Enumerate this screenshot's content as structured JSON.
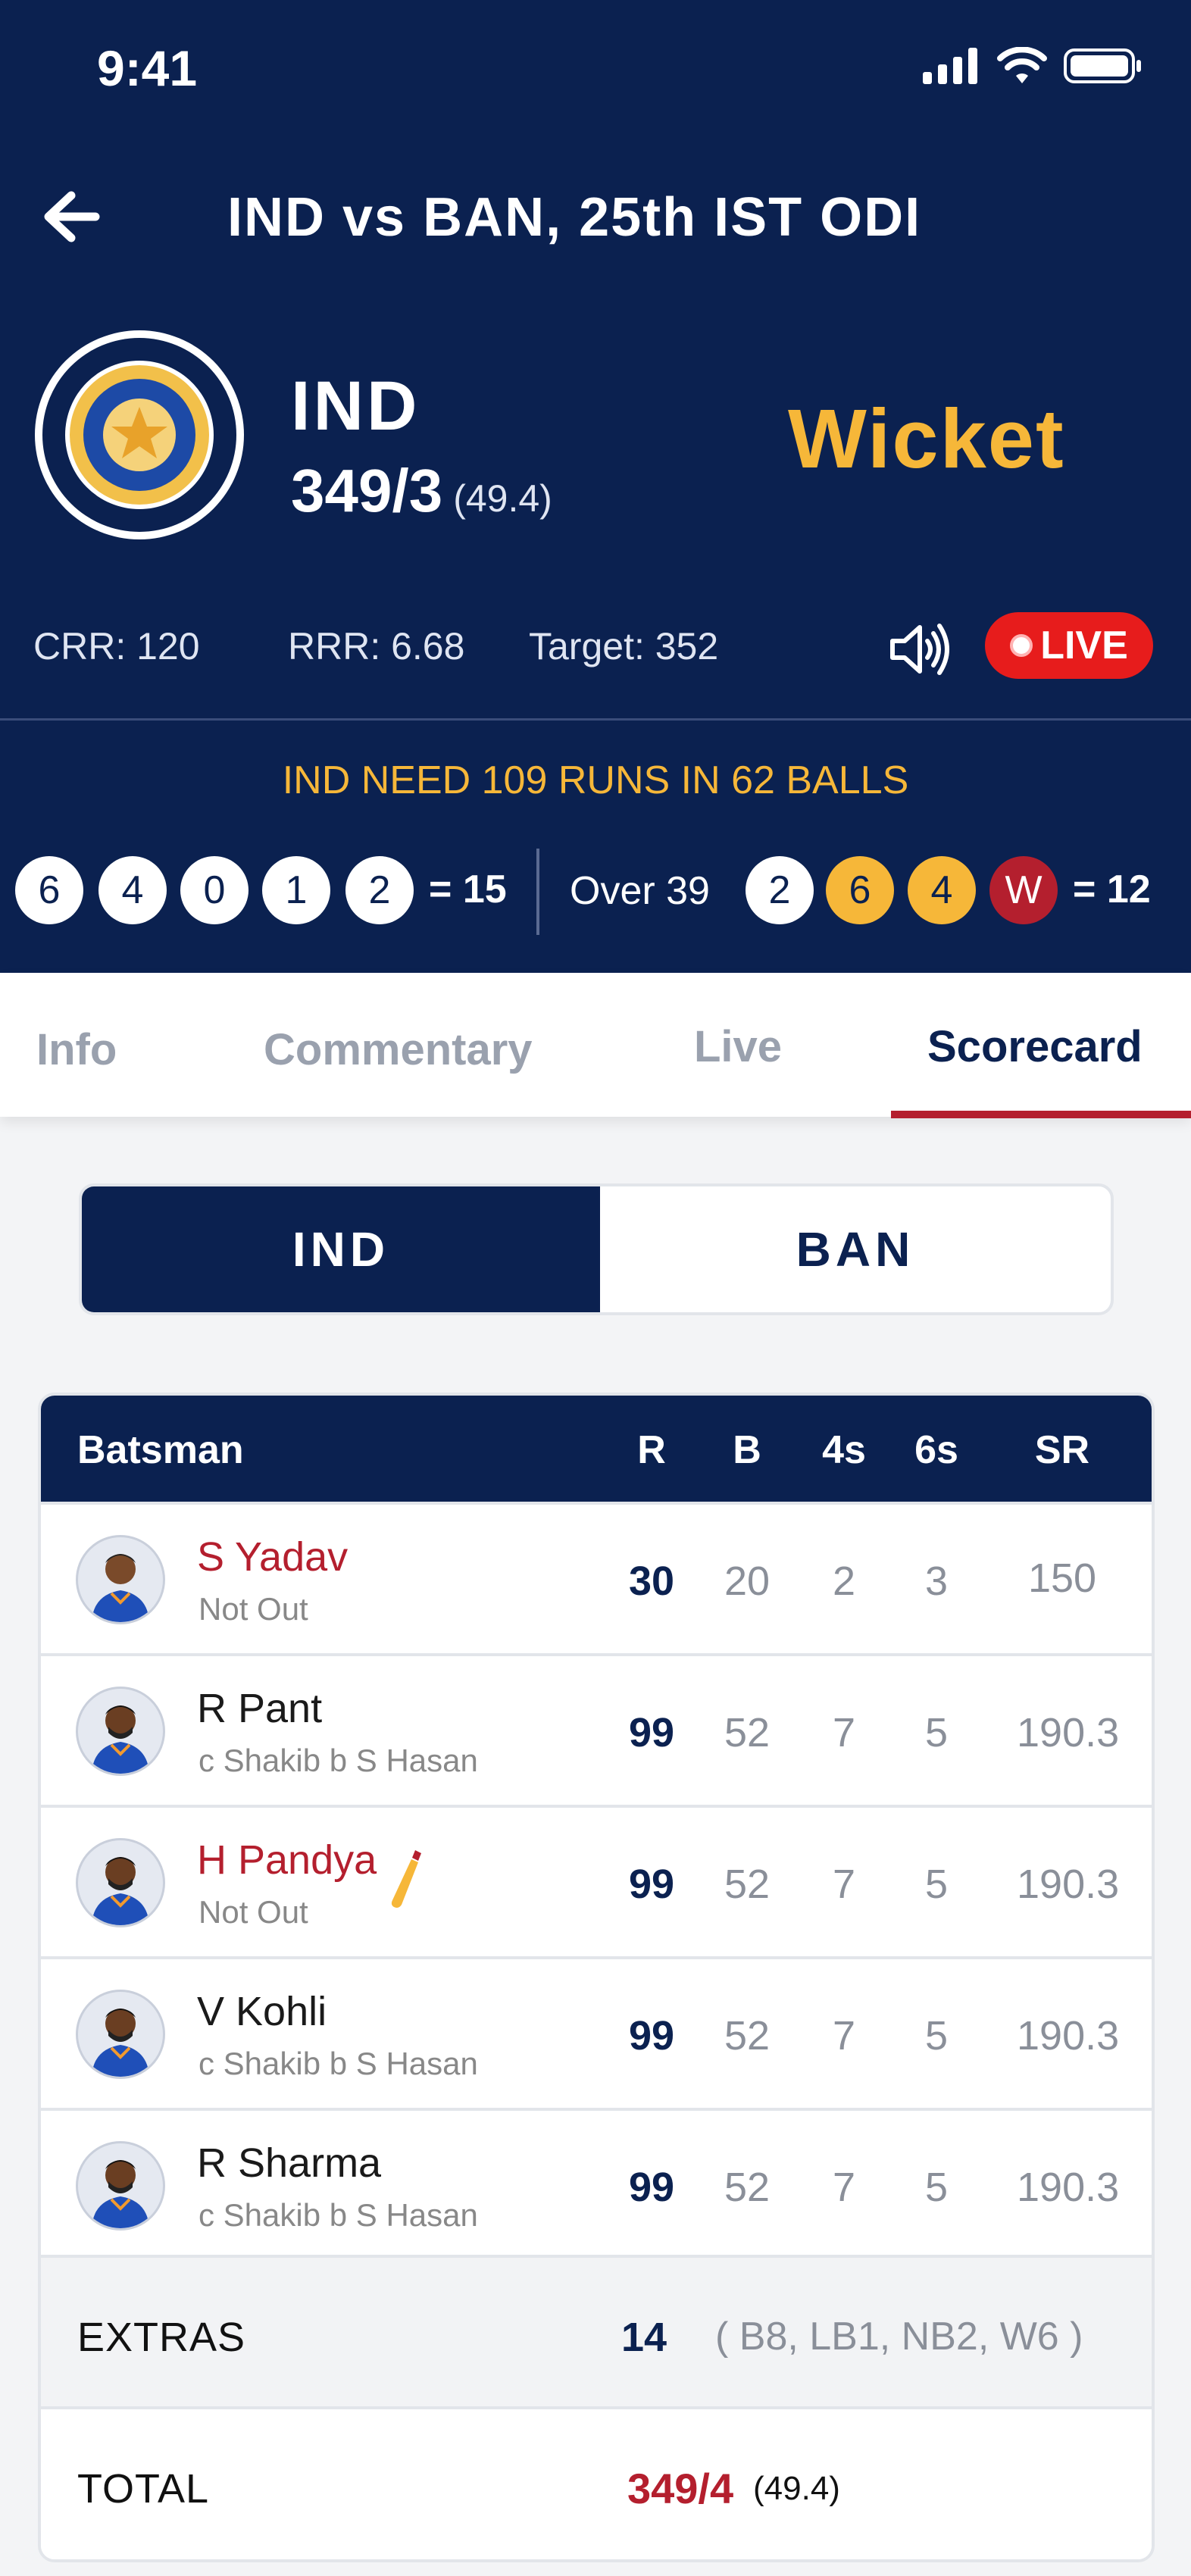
{
  "status": {
    "time": "9:41"
  },
  "match": {
    "title": "IND vs BAN, 25th IST ODI"
  },
  "team": {
    "name": "IND",
    "score": "349/3",
    "overs": "(49.4)",
    "event": "Wicket"
  },
  "rates": {
    "crr": "CRR: 120",
    "rrr": "RRR: 6.68",
    "target": "Target: 352"
  },
  "live_label": "LIVE",
  "need_text": "IND NEED 109 RUNS IN 62 BALLS",
  "current_over": {
    "balls": [
      "6",
      "4",
      "0",
      "1",
      "2"
    ],
    "total": "= 15"
  },
  "previous_over": {
    "label": "Over 39",
    "balls": [
      "2",
      "6",
      "4",
      "W"
    ],
    "total": "= 12"
  },
  "tabs": [
    "Info",
    "Commentary",
    "Live",
    "Scorecard"
  ],
  "active_tab": "Scorecard",
  "team_toggle": {
    "left": "IND",
    "right": "BAN",
    "selected": "IND"
  },
  "table": {
    "headers": [
      "Batsman",
      "R",
      "B",
      "4s",
      "6s",
      "SR"
    ],
    "rows": [
      {
        "name": "S Yadav",
        "desc": "Not Out",
        "r": "30",
        "b": "20",
        "fours": "2",
        "sixes": "3",
        "sr": "150",
        "highlight": true,
        "batting": false
      },
      {
        "name": "R Pant",
        "desc": "c Shakib b S Hasan",
        "r": "99",
        "b": "52",
        "fours": "7",
        "sixes": "5",
        "sr": "190.3",
        "highlight": false,
        "batting": false
      },
      {
        "name": "H Pandya",
        "desc": "Not Out",
        "r": "99",
        "b": "52",
        "fours": "7",
        "sixes": "5",
        "sr": "190.3",
        "highlight": true,
        "batting": true
      },
      {
        "name": "V Kohli",
        "desc": "c Shakib b S Hasan",
        "r": "99",
        "b": "52",
        "fours": "7",
        "sixes": "5",
        "sr": "190.3",
        "highlight": false,
        "batting": false
      },
      {
        "name": "R Sharma",
        "desc": "c Shakib b S Hasan",
        "r": "99",
        "b": "52",
        "fours": "7",
        "sixes": "5",
        "sr": "190.3",
        "highlight": false,
        "batting": false
      }
    ],
    "extras": {
      "label": "EXTRAS",
      "value": "14",
      "detail": "( B8, LB1, NB2, W6 )"
    },
    "total": {
      "label": "TOTAL",
      "value": "349/4",
      "overs": "(49.4)"
    }
  },
  "colors": {
    "navy": "#0b2150",
    "gold": "#f6b739",
    "red": "#b41f2e",
    "live_red": "#e71c1c"
  }
}
